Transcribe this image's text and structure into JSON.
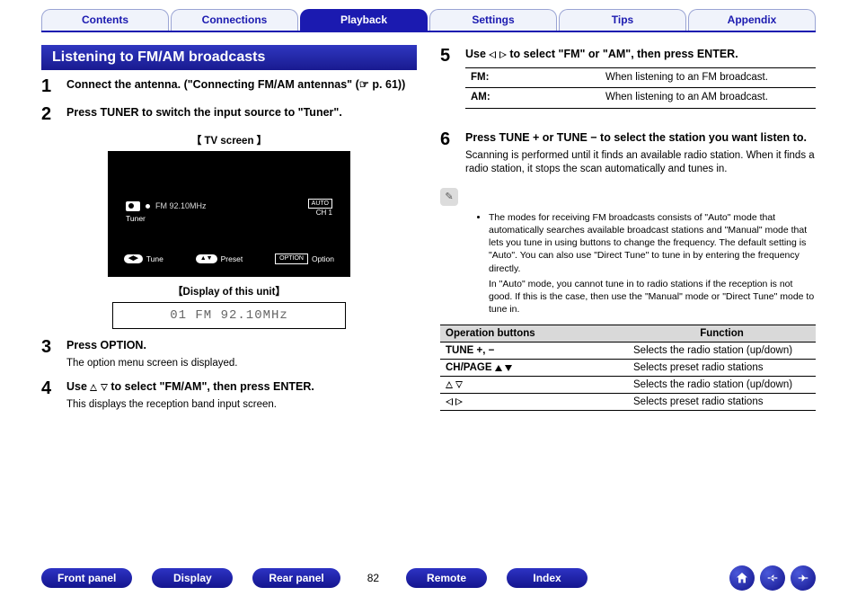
{
  "nav": {
    "tabs": [
      "Contents",
      "Connections",
      "Playback",
      "Settings",
      "Tips",
      "Appendix"
    ],
    "active_index": 2
  },
  "section_title": "Listening to FM/AM broadcasts",
  "left_steps": {
    "s1": {
      "title": "Connect the antenna. (\"Connecting FM/AM antennas\" (☞ p. 61))"
    },
    "s2": {
      "title": "Press TUNER to switch the input source to \"Tuner\"."
    },
    "tv_caption": "【 TV screen 】",
    "tv": {
      "tuner_label": "Tuner",
      "band_text": "FM   92.10MHz",
      "auto": "AUTO",
      "ch": "CH 1",
      "bot_tune": "Tune",
      "bot_preset": "Preset",
      "bot_option_label": "Option",
      "bot_option_btn": "OPTION"
    },
    "unit_caption": "【Display of this unit】",
    "unit_text": "01 FM  92.10MHz",
    "s3": {
      "title": "Press OPTION.",
      "note": "The option menu screen is displayed."
    },
    "s4": {
      "title_prefix": "Use ",
      "title_suffix": " to select \"FM/AM\", then press ENTER.",
      "note": "This displays the reception band input screen."
    }
  },
  "right_steps": {
    "s5": {
      "title_prefix": "Use ",
      "title_suffix": " to select \"FM\" or \"AM\", then press ENTER."
    },
    "fm_am_table": [
      {
        "k": "FM:",
        "v": "When listening to an FM broadcast."
      },
      {
        "k": "AM:",
        "v": "When listening to an AM broadcast."
      }
    ],
    "s6": {
      "title": "Press TUNE + or TUNE − to select the station you want listen to.",
      "note": "Scanning is performed until it finds an available radio station. When it finds a radio station, it stops the scan automatically and tunes in."
    },
    "notes": {
      "b1": "The modes for receiving FM broadcasts consists of \"Auto\" mode that automatically searches available broadcast stations and \"Manual\" mode that lets you tune in using buttons to change the frequency. The default setting is \"Auto\". You can also use \"Direct Tune\" to tune in by entering the frequency directly.",
      "b2": "In \"Auto\" mode, you cannot tune in to radio stations if the reception is not good. If this is the case, then use the \"Manual\" mode or \"Direct Tune\" mode to tune in."
    },
    "ops_header": {
      "a": "Operation buttons",
      "b": "Function"
    },
    "ops": [
      {
        "a": "TUNE +, −",
        "b": "Selects the radio station (up/down)"
      },
      {
        "a": "CH/PAGE",
        "b": "Selects preset radio stations"
      },
      {
        "a": "",
        "b": "Selects the radio station (up/down)"
      },
      {
        "a": "",
        "b": "Selects preset radio stations"
      }
    ]
  },
  "footer": {
    "buttons": [
      "Front panel",
      "Display",
      "Rear panel"
    ],
    "page_no": "82",
    "buttons2": [
      "Remote",
      "Index"
    ]
  }
}
